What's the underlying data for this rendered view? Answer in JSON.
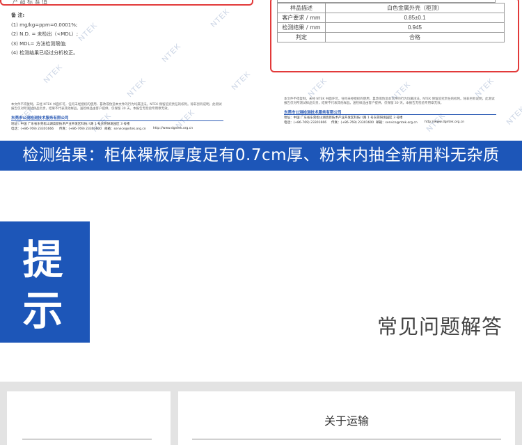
{
  "report_left": {
    "frame_text": "产 超 标 准 值",
    "notes_title": "备 注:",
    "notes": [
      "(1) mg/kg=ppm=0.0001%;",
      "(2) N.D. = 未检出（<MDL）;",
      "(3) MDL= 方法检测限值;",
      "(4) 检测结果已经过分析校正。"
    ],
    "footer_lines": [
      "本文件不得复制。未经 NTEK 书面许可，任何未经授权的使用、篡改或伪造本文件的行为均属违法，NTEK 保留追究责任的权利。除非另有说明，此测试",
      "报告仅对所测试样品负责，结果不代表其他样品。送检样品由客户提供，仅保留 30 天。本报告无检验专用章无效。"
    ],
    "company": "东莞市公测检测技术服务有限公司",
    "address": "地址：中国 广东省东莞松山湖高新技术产业开发区科技八路 1 号东莞研发园区 3 号楼",
    "tel": "电话：(+86-769) 23301666",
    "fax": "传真：(+86-769) 23301600",
    "email": "邮箱：service@ntek.org.cn",
    "web": "http://www.dgntek.org.cn"
  },
  "report_right": {
    "rows": [
      {
        "label": "样品描述",
        "value": "白色金属外壳（柜顶）"
      },
      {
        "label": "客户要求 / mm",
        "value": "0.85±0.1"
      },
      {
        "label": "检测结果 / mm",
        "value": "0.945"
      },
      {
        "label": "判定",
        "value": "合格"
      }
    ],
    "footer_lines": [
      "本文件不得复制。未经 NTEK 书面许可，任何未经授权的使用、篡改或伪造本文件的行为均属违法，NTEK 保留追究责任的权利。除非另有说明，此测试",
      "报告仅对所测试样品负责，结果不代表其他样品。送检样品由客户提供，仅保留 30 天。本报告无检验专用章无效。"
    ],
    "company": "东莞市公测检测技术服务有限公司",
    "address": "地址：中国 广东省东莞松山湖高新技术产业开发区科技八路 1 号东莞研发园区 3 号楼",
    "tel": "电话：(+86-769) 23301666",
    "fax": "传真：(+86-769) 23301600",
    "email": "邮箱：service@ntek.org.cn",
    "web": "http://www.dgntek.org.cn"
  },
  "watermark": "NTEK",
  "banner": {
    "text": "检测结果：柜体裸板厚度足有0.7cm厚、粉末内抽全新用料无杂质"
  },
  "tip": {
    "chars": [
      "提",
      "示"
    ],
    "heading": "常见问题解答"
  },
  "cards": {
    "right_title": "关于运输"
  },
  "colors": {
    "brand_blue": "#1d56b8",
    "highlight_red": "#e23a3a",
    "card_bg": "#e3e3e3"
  }
}
